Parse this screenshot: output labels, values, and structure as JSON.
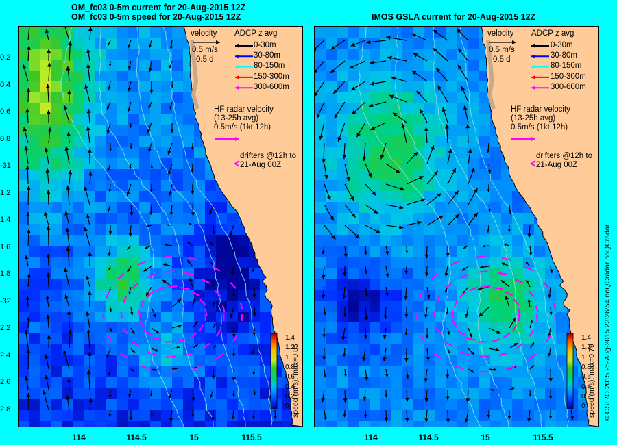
{
  "titles": {
    "left_line1": "OM_fc03 0-5m current for 20-Aug-2015 12Z",
    "left_line2": "OM_fc03 0-5m speed for 20-Aug-2015 12Z",
    "right_line1": "IMOS GSLA current for 20-Aug-2015 12Z"
  },
  "y_ticks": [
    "0.2",
    "0.4",
    "0.6",
    "0.8",
    "-31",
    "1.2",
    "1.4",
    "1.6",
    "1.8",
    "-32",
    "2.2",
    "2.4",
    "2.6",
    "2.8"
  ],
  "x_ticks": [
    "114",
    "114.5",
    "15",
    "115.5"
  ],
  "legend": {
    "velocity_title": "velocity",
    "velocity_scale": "0.5 m/s",
    "velocity_time": "0.5 d",
    "adcp_title": "ADCP z avg",
    "adcp_items": [
      {
        "label": "0-30m",
        "color": "#000000"
      },
      {
        "label": "30-80m",
        "color": "#0000ff"
      },
      {
        "label": "80-150m",
        "color": "#00ffff"
      },
      {
        "label": "150-300m",
        "color": "#ff0000"
      },
      {
        "label": "300-600m",
        "color": "#ff00ff"
      }
    ],
    "hf_line1": "HF radar velocity",
    "hf_line2": "(13-25h avg)",
    "hf_line3": "0.5m/s (1kt 12h)",
    "drifters_line1": "drifters @12h to",
    "drifters_line2": "21-Aug 00Z"
  },
  "colorbar": {
    "ticks": [
      "1.4",
      "1.2",
      "1",
      "0.8",
      "0.6",
      "0.4",
      "0.2",
      "0"
    ],
    "left_label": "speed (m/s), max=0.85",
    "right_label": "speed (m/s), max=0.79"
  },
  "credit": "© CSIRO 2015   25-Aug-2015 23:26:54 noQCradar noQCradar",
  "colors": {
    "background": "#00ffff",
    "land": "#ffcc99",
    "coast": "#c8a98a",
    "hf_radar": "#ff00ff",
    "arrow": "#000000"
  }
}
